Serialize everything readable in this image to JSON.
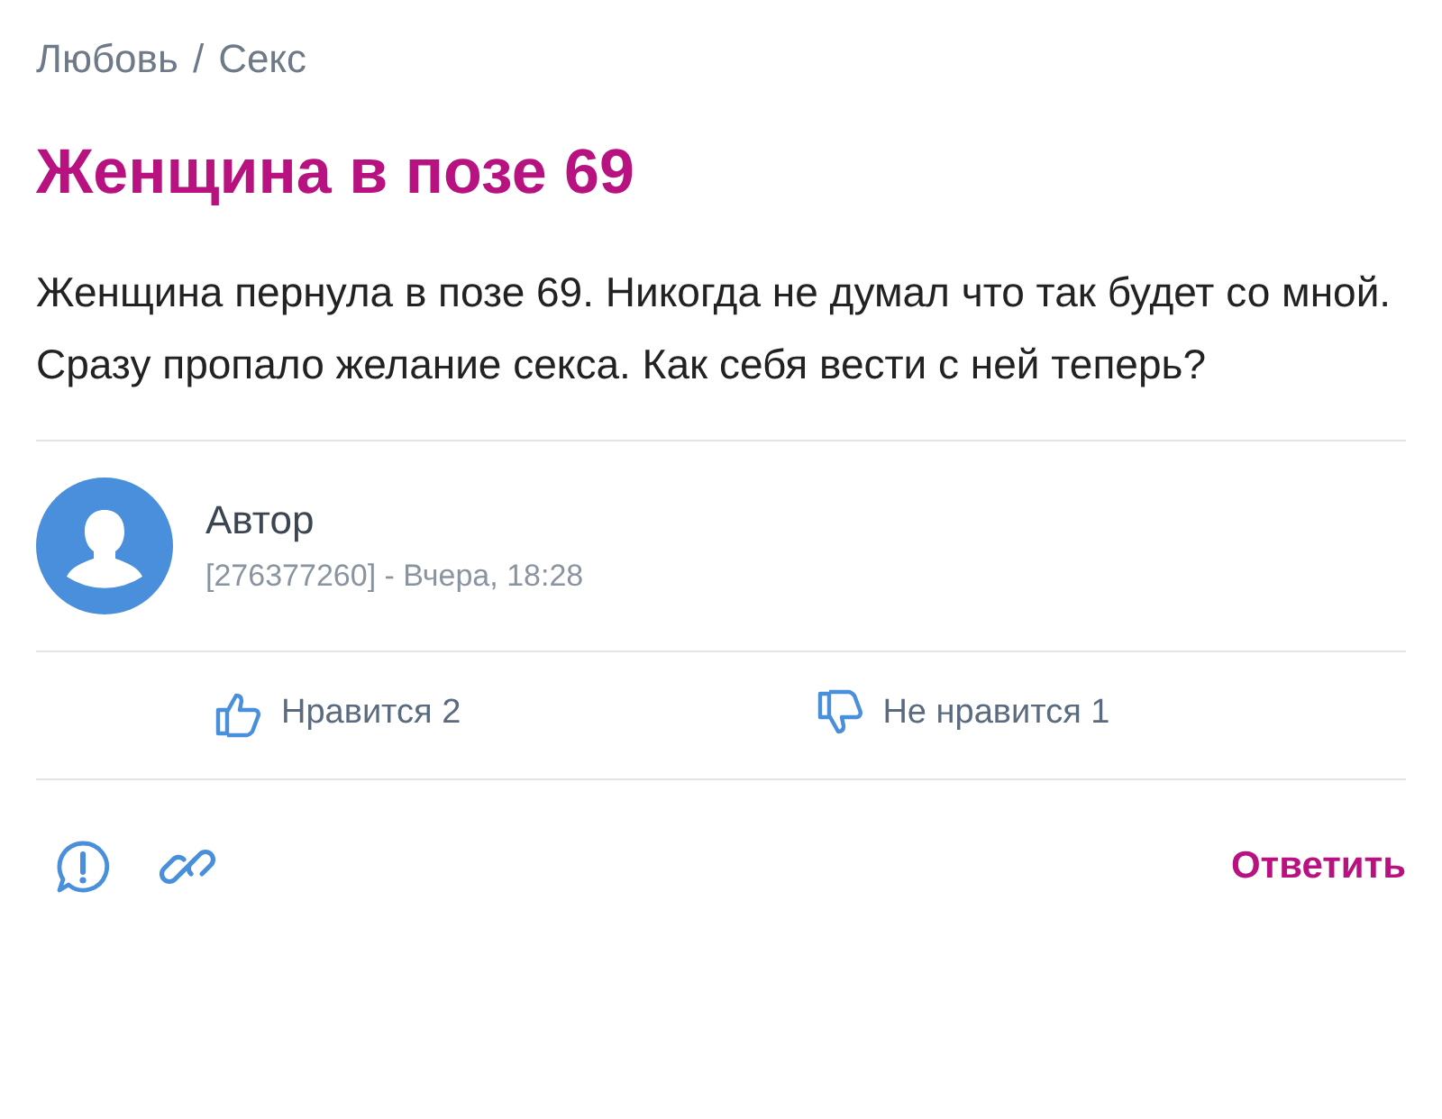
{
  "breadcrumb": {
    "items": [
      "Любовь",
      "Секс"
    ],
    "separator": "/"
  },
  "question": {
    "title": "Женщина в позе 69",
    "text": "Женщина пернула в позе 69. Никогда не думал что так будет со мной. Сразу пропало желание секса. Как себя вести с ней теперь?"
  },
  "author": {
    "name": "Автор",
    "meta": "[276377260] - Вчера, 18:28"
  },
  "votes": [
    {
      "kind": "like",
      "label": "Нравится 2"
    },
    {
      "kind": "dislike",
      "label": "Не нравится 1"
    }
  ],
  "actions": {
    "reply": "Ответить"
  }
}
